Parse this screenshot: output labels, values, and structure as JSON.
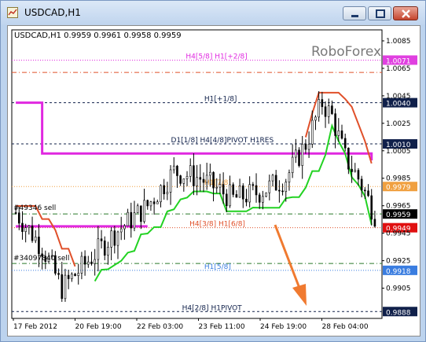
{
  "window": {
    "title": "USDCAD,H1",
    "minimize_icon": "minimize-icon",
    "maximize_icon": "maximize-icon",
    "close_icon": "close-icon"
  },
  "colors": {
    "accent_magenta": "#e028e0",
    "resistance_red": "#e0502a",
    "support_green": "#22d222",
    "pivot_orange": "#f28a2e",
    "arrow_orange": "#f07a30",
    "label_red_bg": "#e01010",
    "label_navy_bg": "#10204a",
    "label_blue_bg": "#3a7de0",
    "label_orange_bg": "#f0a040",
    "label_magenta_bg": "#e040e0"
  },
  "chart_header": "USDCAD,H1  0.9959 0.9961 0.9958 0.9959",
  "watermark": "RoboForex",
  "chart_data": {
    "type": "candlestick",
    "symbol": "USDCAD,H1",
    "ohlc": {
      "open": 0.9959,
      "high": 0.9961,
      "low": 0.9958,
      "close": 0.9959
    },
    "ylim": [
      0.9883,
      1.0093
    ],
    "y_ticks": [
      1.0085,
      1.0065,
      1.0045,
      1.0025,
      1.0005,
      0.9985,
      0.9965,
      0.9945,
      0.9925,
      0.9905
    ],
    "x_tick_labels": [
      "17 Feb 2012",
      "20 Feb 19:00",
      "22 Feb 03:00",
      "23 Feb 11:00",
      "24 Feb 19:00",
      "28 Feb 04:00"
    ],
    "price_labels": [
      {
        "value": "1.0071",
        "price": 1.0071,
        "style": "magenta"
      },
      {
        "value": "1.0040",
        "price": 1.004,
        "style": "navy"
      },
      {
        "value": "1.0010",
        "price": 1.001,
        "style": "navy"
      },
      {
        "value": "0.9979",
        "price": 0.9979,
        "style": "orange"
      },
      {
        "value": "0.9959",
        "price": 0.9959,
        "style": "current"
      },
      {
        "value": "0.9949",
        "price": 0.9949,
        "style": "red"
      },
      {
        "value": "0.9918",
        "price": 0.9918,
        "style": "blue"
      },
      {
        "value": "0.9888",
        "price": 0.9888,
        "style": "navy"
      }
    ],
    "level_lines": [
      {
        "label": "H4[5/8] H1[+2/8]",
        "price": 1.0071,
        "color": "#e028e0",
        "style": "dotted",
        "x_ratio": 0.47
      },
      {
        "label": "",
        "price": 1.0062,
        "color": "#e0502a",
        "style": "dashdot",
        "x_ratio": 0
      },
      {
        "label": "H1[+1/8]",
        "price": 1.004,
        "color": "#10204a",
        "style": "dashed",
        "x_ratio": 0.52
      },
      {
        "label": "D1[1/8] H4[4/8]PIVOT H1RES",
        "price": 1.001,
        "color": "#10204a",
        "style": "dashed",
        "x_ratio": 0.43
      },
      {
        "label": "H1[7/8]",
        "price": 0.9979,
        "color": "#f0a040",
        "style": "dotted",
        "x_ratio": 0.52
      },
      {
        "label": "",
        "price": 0.9959,
        "color": "#2a7a2a",
        "style": "dashdot",
        "x_ratio": 0
      },
      {
        "label": "H4[3/8] H1[6/8]",
        "price": 0.9949,
        "color": "#e0502a",
        "style": "dotted",
        "x_ratio": 0.48
      },
      {
        "label": "",
        "price": 0.9923,
        "color": "#2a7a2a",
        "style": "dashdot",
        "x_ratio": 0
      },
      {
        "label": "H1[5/8]",
        "price": 0.9918,
        "color": "#3a7de0",
        "style": "dotted",
        "x_ratio": 0.52
      },
      {
        "label": "H4[2/8] H1PIVOT",
        "price": 0.9888,
        "color": "#10204a",
        "style": "dashed",
        "x_ratio": 0.46
      }
    ],
    "order_labels": [
      {
        "label": "#49346 sell",
        "price": 0.9962
      },
      {
        "label": "#34097840 sell",
        "price": 0.9923
      }
    ],
    "forecast": "down"
  }
}
